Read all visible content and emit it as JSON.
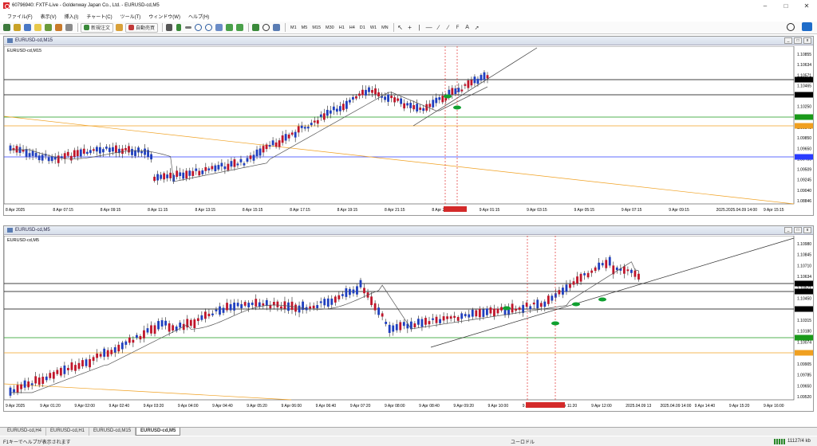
{
  "window": {
    "title": "60796940: FXTF-Live - Goldenway Japan Co., Ltd. - EURUSD-cd,M5"
  },
  "menu": [
    "ファイル(F)",
    "表示(V)",
    "挿入(I)",
    "チャート(C)",
    "ツール(T)",
    "ウィンドウ(W)",
    "ヘルプ(H)"
  ],
  "toolbar": {
    "new_order": "新規注文",
    "auto_trading": "自動売買",
    "timeframes": [
      "M1",
      "M5",
      "M15",
      "M30",
      "H1",
      "H4",
      "D1",
      "W1",
      "MN"
    ]
  },
  "charts": [
    {
      "title": "EURUSD-cd,M15",
      "inner_label": "EURUSD-cd,M15",
      "price_labels": [
        "1.10855",
        "1.10634",
        "1.10571",
        "1.10465",
        "1.10348",
        "1.10250",
        "1.10074",
        "1.09845",
        "1.09850",
        "1.09650",
        "1.09450",
        "1.09509",
        "1.09245",
        "1.09040",
        "1.08846"
      ],
      "time_labels": [
        "8 Apr 2025",
        "8 Apr 07:15",
        "8 Apr 09:15",
        "8 Apr 11:15",
        "8 Apr 13:15",
        "8 Apr 15:15",
        "8 Apr 17:15",
        "8 Apr 19:15",
        "8 Apr 21:15",
        "8 Apr 23:15",
        "9 Apr 01:15",
        "9 Apr 03:15",
        "9 Apr 05:15",
        "9 Apr 07:15",
        "9 Apr 09:15",
        "2025.2025.04.09 14:00",
        "9 Apr 15:15"
      ]
    },
    {
      "title": "EURUSD-cd,M5",
      "inner_label": "EURUSD-cd,M5",
      "price_labels": [
        "1.10980",
        "1.10845",
        "1.10710",
        "1.10634",
        "1.10571",
        "1.10450",
        "1.10348",
        "1.10315",
        "1.10180",
        "1.10074",
        "1.09915",
        "1.09905",
        "1.09785",
        "1.09650",
        "1.09520"
      ],
      "time_labels": [
        "9 Apr 2025",
        "9 Apr 01:20",
        "9 Apr 02:00",
        "9 Apr 02:40",
        "9 Apr 03:20",
        "9 Apr 04:00",
        "9 Apr 04:40",
        "9 Apr 05:20",
        "9 Apr 06:00",
        "9 Apr 06:40",
        "9 Apr 07:20",
        "9 Apr 08:00",
        "9 Apr 08:40",
        "9 Apr 09:20",
        "9 Apr 10:00",
        "9 Apr 10:40",
        "9 Apr 11:20",
        "9 Apr 12:00",
        "2025.04.09 13",
        "2025.04.09 14:00",
        "9 Apr 14:40",
        "9 Apr 15:20",
        "9 Apr 16:00"
      ]
    }
  ],
  "tabs": [
    "EURUSD-cd,H4",
    "EURUSD-cd,H1",
    "EURUSD-cd,M15",
    "EURUSD-cd,M5"
  ],
  "active_tab": "EURUSD-cd,M5",
  "status": {
    "help": "F1キーでヘルプが表示されます",
    "profile": "ユーロドル",
    "traffic": "11127/4 kb"
  },
  "colors": {
    "bull": "#c0152a",
    "bear": "#1f3fbf",
    "green_line": "#1a9a1a",
    "orange_line": "#f0a020",
    "blue_line": "#2a3cff",
    "ma": "#555555"
  }
}
